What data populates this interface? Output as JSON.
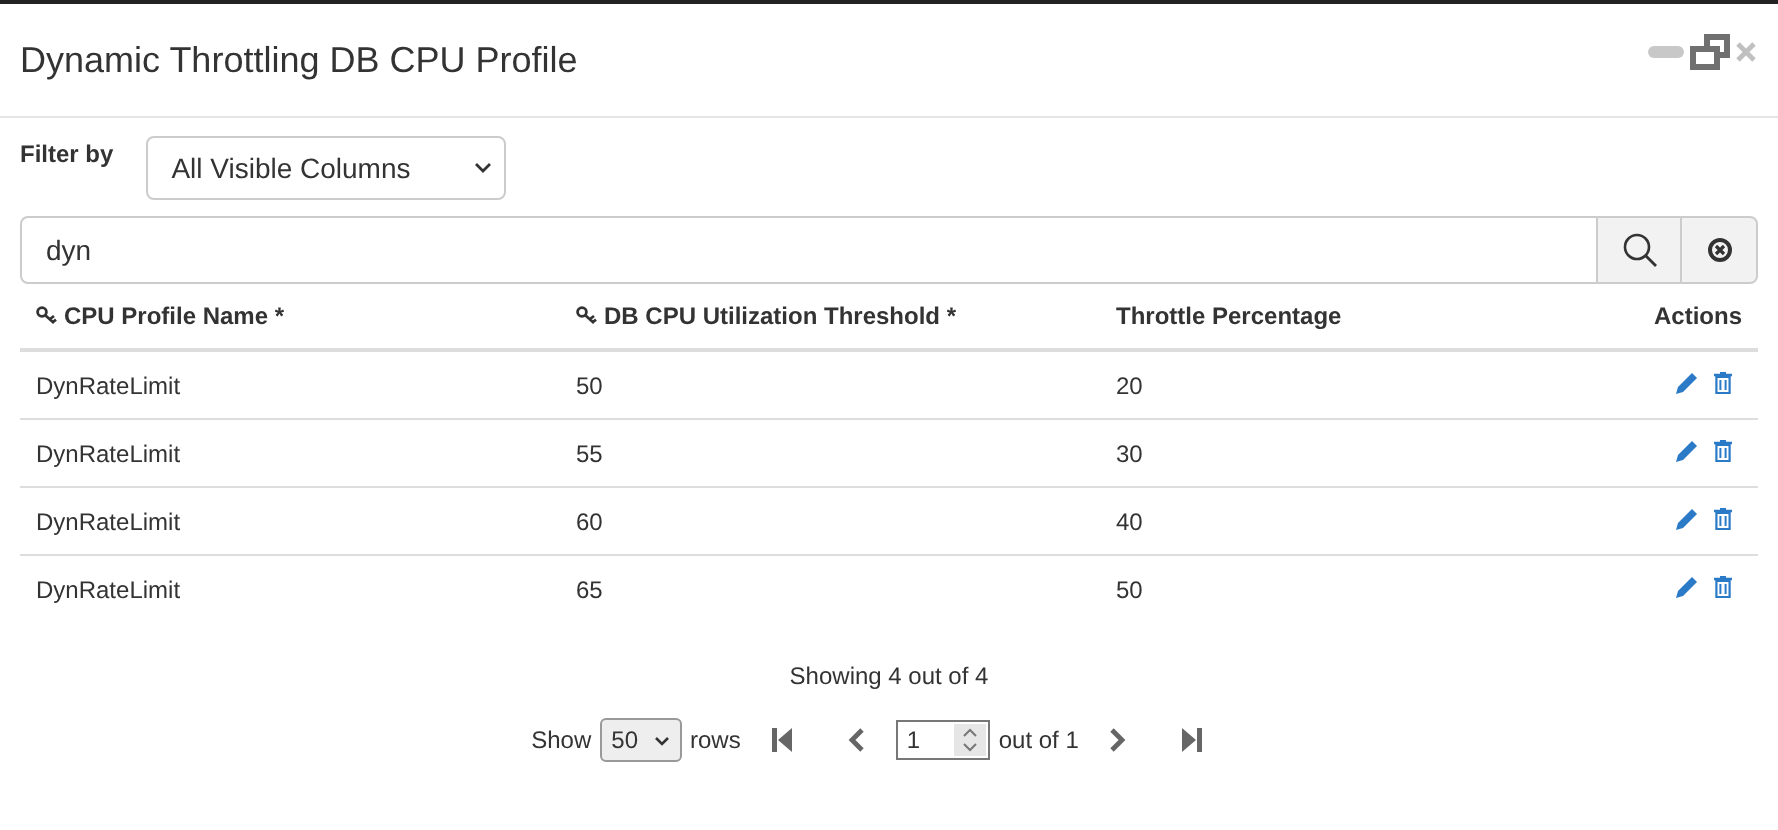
{
  "window": {
    "title": "Dynamic Throttling DB CPU Profile"
  },
  "filter": {
    "label": "Filter by",
    "value": "All Visible Columns"
  },
  "search": {
    "value": "dyn"
  },
  "table": {
    "columns": [
      {
        "label": "CPU Profile Name *",
        "key": true
      },
      {
        "label": "DB CPU Utilization Threshold *",
        "key": true
      },
      {
        "label": "Throttle Percentage",
        "key": false
      },
      {
        "label": "Actions",
        "key": false
      }
    ],
    "rows": [
      [
        "DynRateLimit",
        "50",
        "20"
      ],
      [
        "DynRateLimit",
        "55",
        "30"
      ],
      [
        "DynRateLimit",
        "60",
        "40"
      ],
      [
        "DynRateLimit",
        "65",
        "50"
      ]
    ]
  },
  "footer": {
    "summary": "Showing 4 out of 4",
    "show_label": "Show",
    "page_size": "50",
    "rows_label": "rows",
    "page": "1",
    "page_total": "out of 1"
  }
}
